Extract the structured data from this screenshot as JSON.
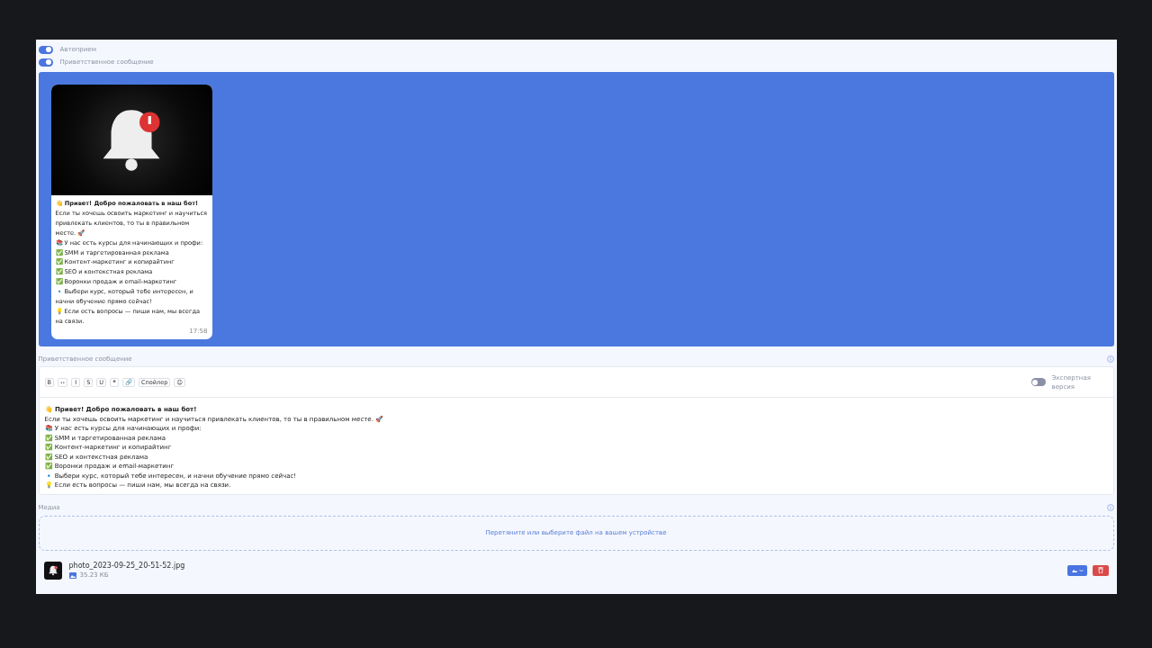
{
  "toggles": [
    {
      "label": "Автоприем",
      "on": true
    },
    {
      "label": "Приветственное сообщение",
      "on": true
    }
  ],
  "preview": {
    "title": "👋 Привет! Добро пожаловать в наш бот!",
    "lines": [
      "Если ты хочешь освоить маркетинг и научиться привлекать клиентов, то ты в правильном месте. 🚀",
      "📚 У нас есть курсы для начинающих и профи:",
      "✅ SMM и таргетированная реклама",
      "✅ Контент-маркетинг и копирайтинг",
      "✅ SEO и контекстная реклама",
      "✅ Воронки продаж и email-маркетинг",
      "🔹 Выбери курс, который тебе интересен, и начни обучение прямо сейчас!",
      "💡 Если есть вопросы — пиши нам, мы всегда на связи."
    ],
    "time": "17:58"
  },
  "editor": {
    "label": "Приветственное сообщение",
    "toolbar": [
      "B",
      "‹›",
      "I",
      "S",
      "U",
      "❝",
      "🔗",
      "Спойлер",
      "☺"
    ],
    "expert": {
      "label": "Экспертная версия",
      "on": false
    },
    "title": "👋 Привет! Добро пожаловать в наш бот!",
    "lines": [
      "Если ты хочешь освоить маркетинг и научиться привлекать клиентов, то ты в правильном месте. 🚀",
      "📚 У нас есть курсы для начинающих и профи:",
      "✅ SMM и таргетированная реклама",
      "✅ Контент-маркетинг и копирайтинг",
      "✅ SEO и контекстная реклама",
      "✅ Воронки продаж и email-маркетинг",
      "🔹 Выбери курс, который тебе интересен, и начни обучение прямо сейчас!",
      "💡 Если есть вопросы — пиши нам, мы всегда на связи."
    ]
  },
  "media": {
    "label": "Медиа",
    "dropzone": "Перетяните или выберите файл на вашем устройстве",
    "file": {
      "name": "photo_2023-09-25_20-51-52.jpg",
      "size": "35.23 КБ"
    }
  }
}
